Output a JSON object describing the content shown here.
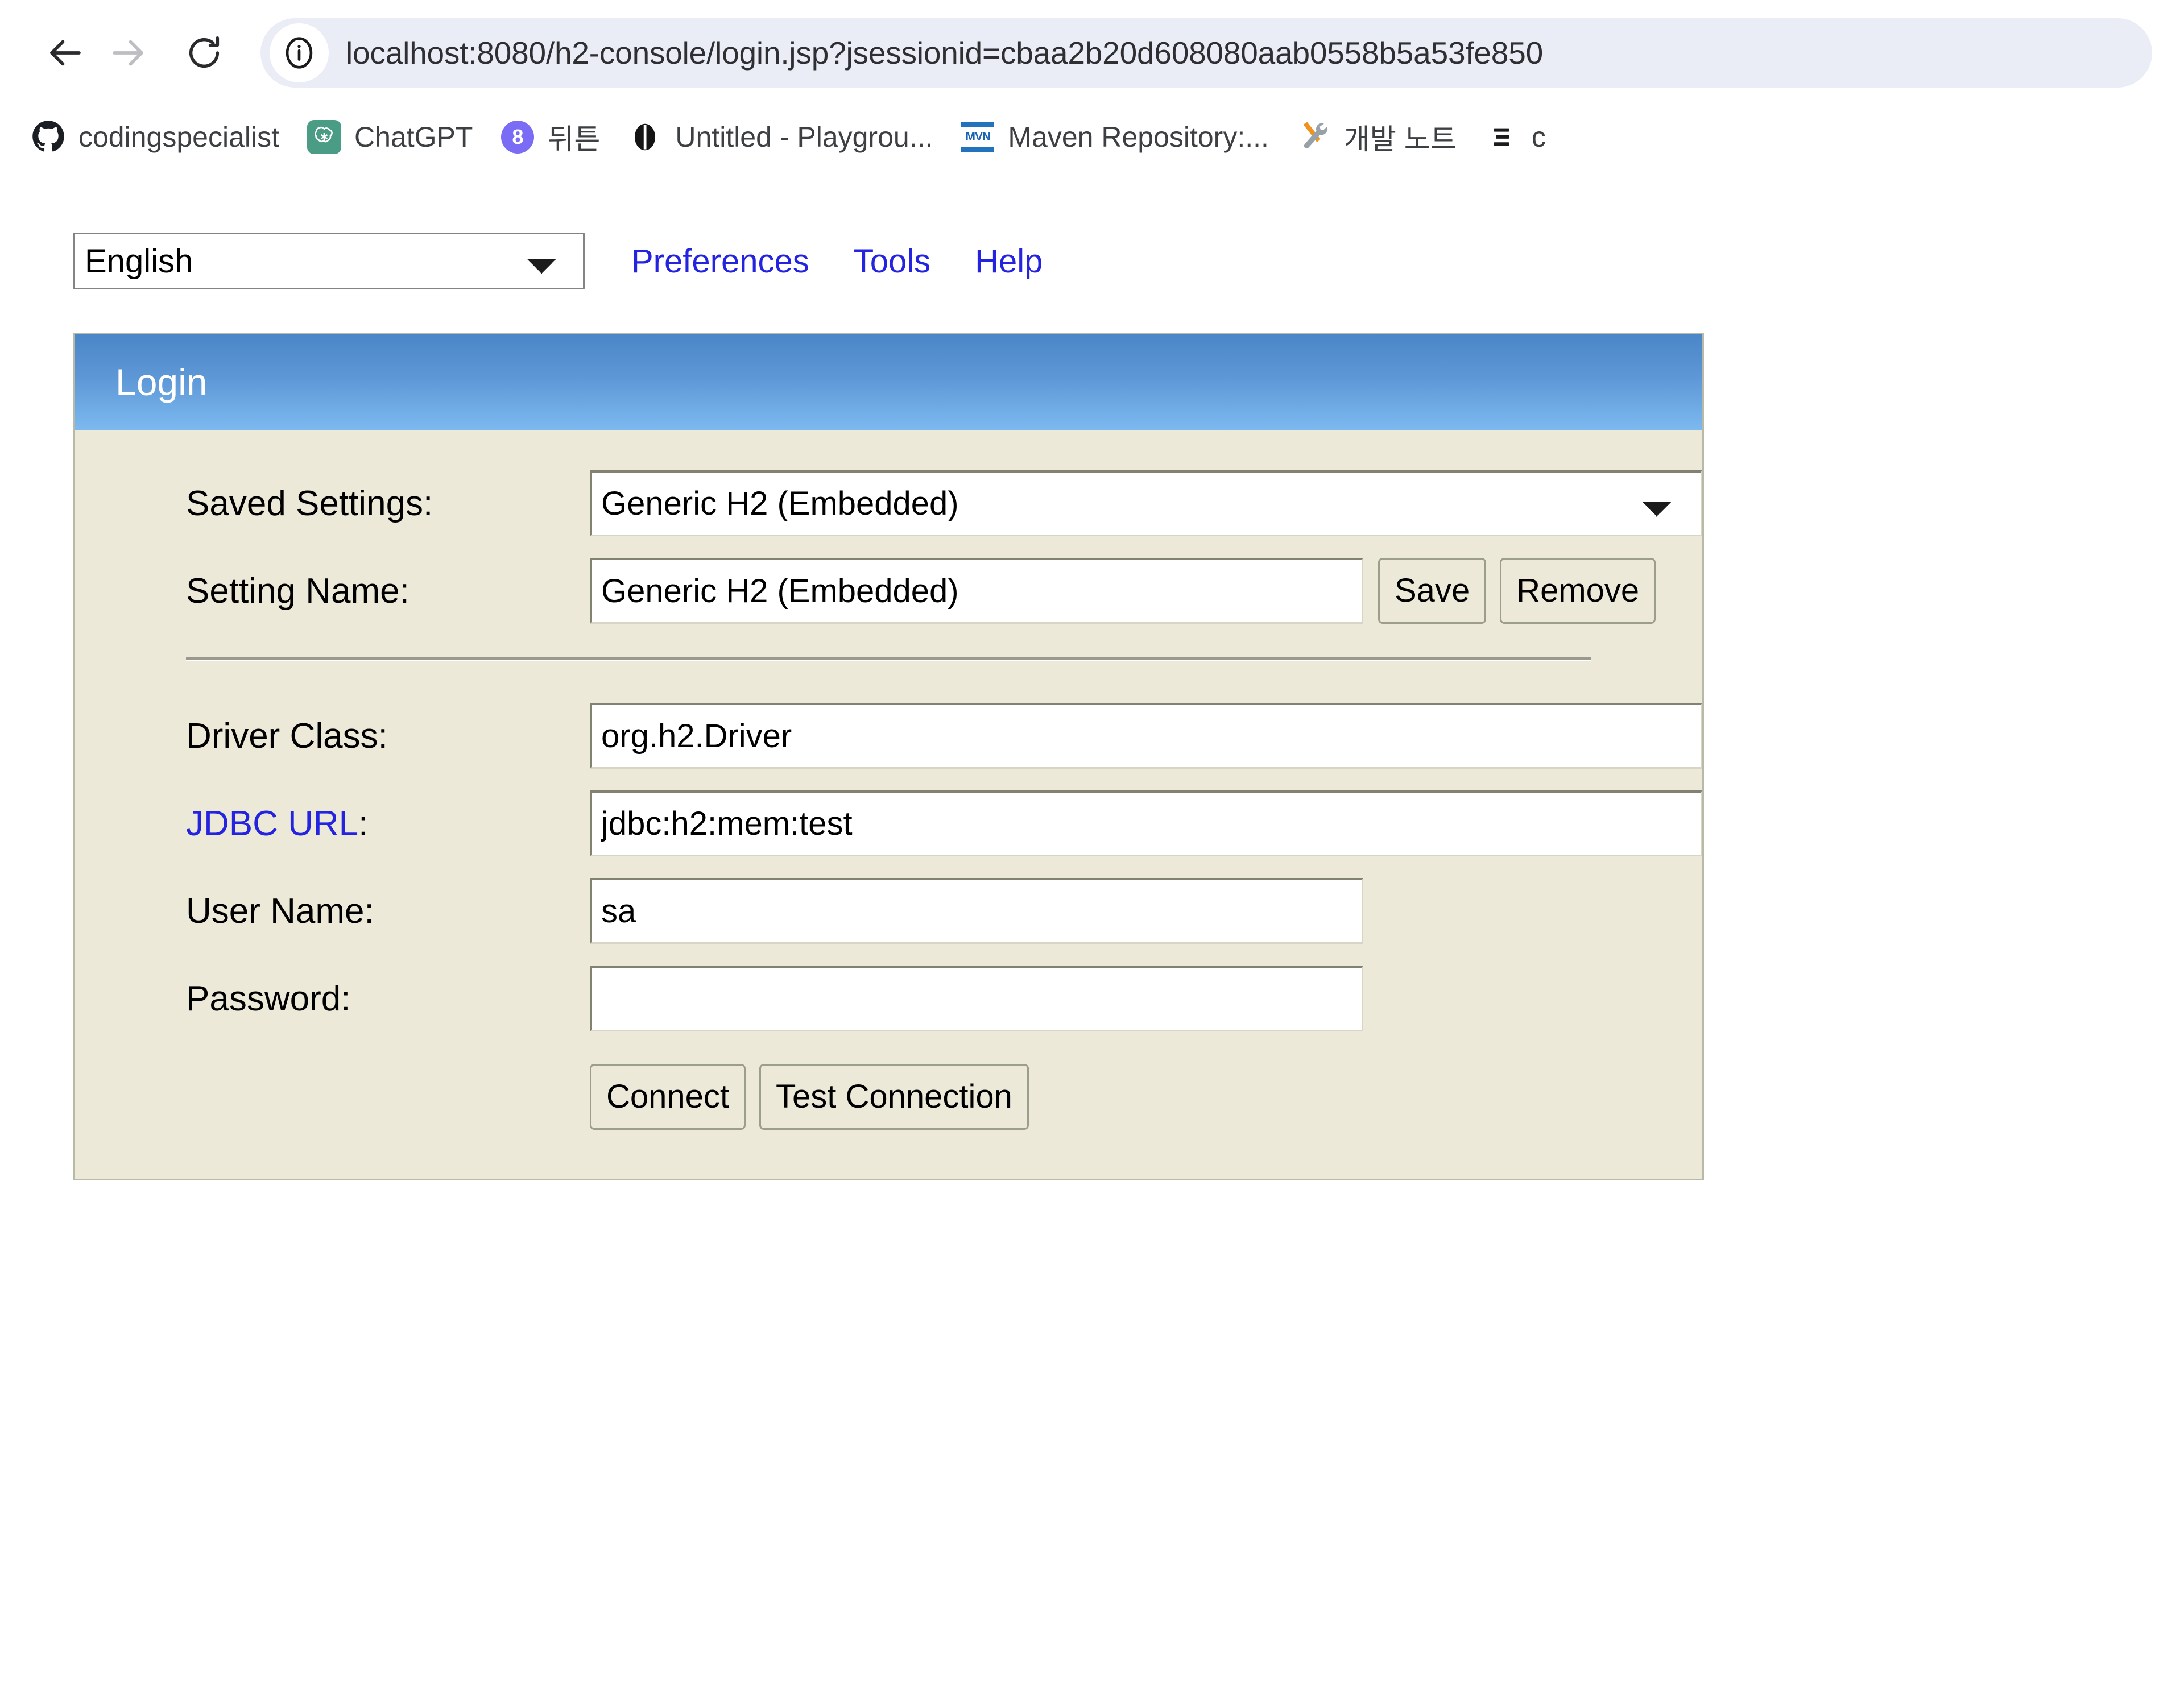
{
  "browser": {
    "nav": {
      "back_label": "Back",
      "forward_label": "Forward",
      "reload_label": "Reload",
      "site_info_label": "Site information"
    },
    "omnibox": {
      "url": "localhost:8080/h2-console/login.jsp?jsessionid=cbaa2b20d608080aab0558b5a53fe850",
      "placeholder": "Search Google or type a URL"
    },
    "bookmarks": [
      {
        "label": "codingspecialist",
        "icon": "github-icon"
      },
      {
        "label": "ChatGPT",
        "icon": "chatgpt-icon"
      },
      {
        "label": "뒤튼",
        "icon": "wrtn-icon"
      },
      {
        "label": "Untitled - Playgrou...",
        "icon": "anthropic-icon"
      },
      {
        "label": "Maven Repository:...",
        "icon": "maven-icon"
      },
      {
        "label": "개발 노트",
        "icon": "tools-icon"
      },
      {
        "label": "c",
        "icon": "list-icon"
      }
    ]
  },
  "h2_console": {
    "toolbar": {
      "language": {
        "selected": "English",
        "options": [
          "English"
        ]
      },
      "links": [
        {
          "label": "Preferences",
          "name": "preferences-link"
        },
        {
          "label": "Tools",
          "name": "tools-link"
        },
        {
          "label": "Help",
          "name": "help-link"
        }
      ]
    },
    "login_panel": {
      "title": "Login",
      "saved_settings": {
        "label": "Saved Settings:",
        "selected": "Generic H2 (Embedded)",
        "options": [
          "Generic H2 (Embedded)"
        ]
      },
      "setting_name": {
        "label": "Setting Name:",
        "value": "Generic H2 (Embedded)",
        "save_label": "Save",
        "remove_label": "Remove"
      },
      "driver_class": {
        "label": "Driver Class:",
        "value": "org.h2.Driver"
      },
      "jdbc_url": {
        "label_link": "JDBC URL",
        "label_suffix": ":",
        "value": "jdbc:h2:mem:test"
      },
      "user_name": {
        "label": "User Name:",
        "value": "sa"
      },
      "password": {
        "label": "Password:",
        "value": ""
      },
      "actions": {
        "connect_label": "Connect",
        "test_connection_label": "Test Connection"
      }
    }
  },
  "colors": {
    "panel_header_top": "#4b86c8",
    "panel_header_bottom": "#7cb9ef",
    "panel_background": "#ece9d8",
    "link_color": "#2424e0",
    "omnibox_background": "#eaedf5"
  }
}
